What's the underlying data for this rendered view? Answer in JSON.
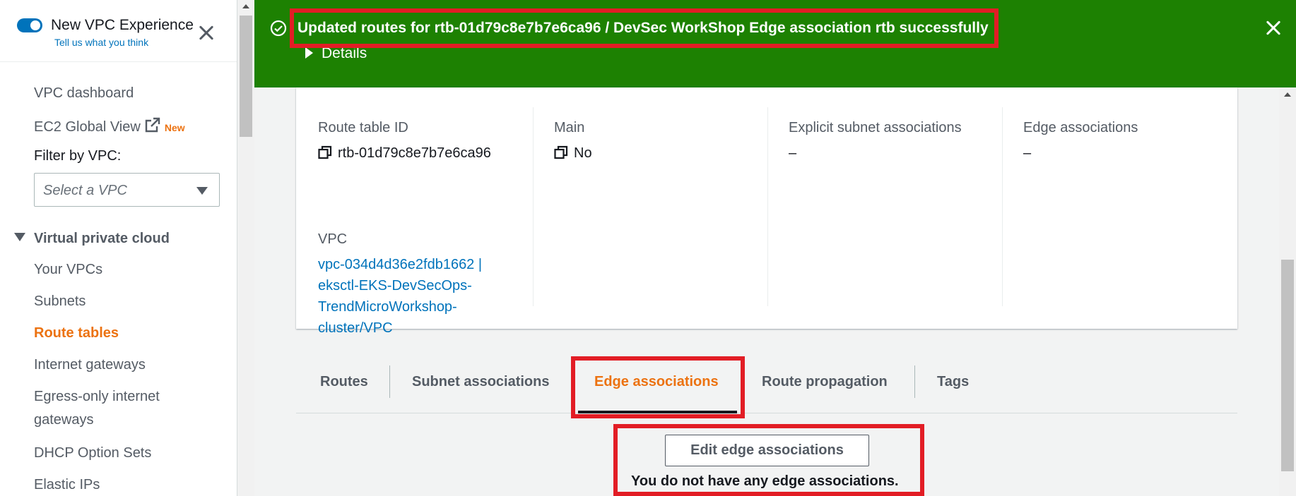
{
  "sidebar": {
    "experience_title": "New VPC Experience",
    "experience_link": "Tell us what you think",
    "items_top": [
      {
        "label": "VPC dashboard"
      },
      {
        "label": "EC2 Global View",
        "badge": "New"
      }
    ],
    "filter_label": "Filter by VPC:",
    "filter_placeholder": "Select a VPC",
    "section_title": "Virtual private cloud",
    "items": [
      {
        "label": "Your VPCs"
      },
      {
        "label": "Subnets"
      },
      {
        "label": "Route tables"
      },
      {
        "label": "Internet gateways"
      },
      {
        "label": "Egress-only internet"
      },
      {
        "label": "gateways"
      },
      {
        "label": "DHCP Option Sets"
      },
      {
        "label": "Elastic IPs"
      }
    ]
  },
  "flash": {
    "message": "Updated routes for rtb-01d79c8e7b7e6ca96 / DevSec WorkShop Edge association rtb successfully",
    "details_label": "Details",
    "color": "#1d8102"
  },
  "details": {
    "route_table_id_label": "Route table ID",
    "route_table_id": "rtb-01d79c8e7b7e6ca96",
    "main_label": "Main",
    "main_value": "No",
    "explicit_label": "Explicit subnet associations",
    "explicit_value": "–",
    "edge_label": "Edge associations",
    "edge_value": "–",
    "vpc_label": "VPC",
    "vpc_lines": [
      "vpc-034d4d36e2fdb1662 |",
      "eksctl-EKS-DevSecOps-",
      "TrendMicroWorkshop-",
      "cluster/VPC"
    ]
  },
  "tabs": [
    {
      "label": "Routes"
    },
    {
      "label": "Subnet associations"
    },
    {
      "label": "Edge associations"
    },
    {
      "label": "Route propagation"
    },
    {
      "label": "Tags"
    }
  ],
  "empty_state": {
    "button_label": "Edit edge associations",
    "message": "You do not have any edge associations."
  },
  "colors": {
    "accent_orange": "#ec7211",
    "link_blue": "#0073bb",
    "highlight_red": "#e21d25"
  }
}
